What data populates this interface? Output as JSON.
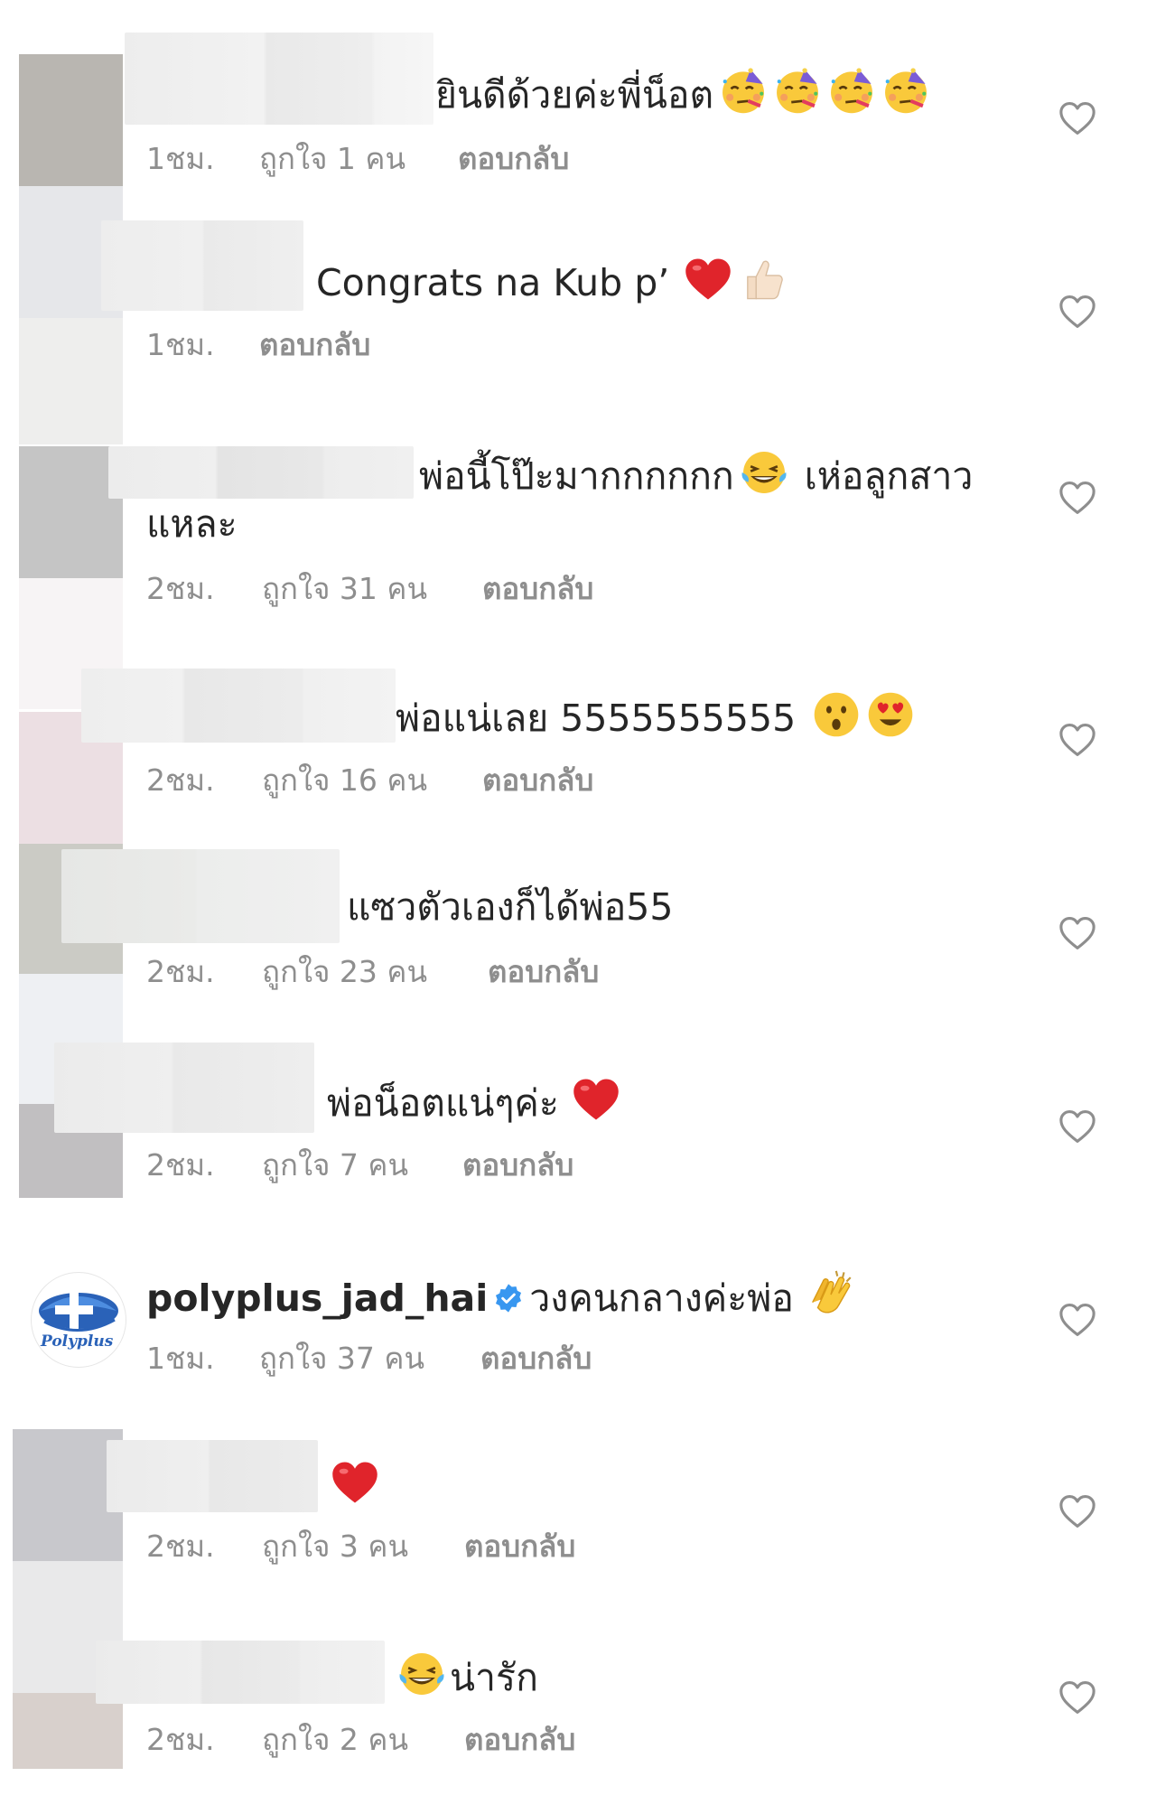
{
  "comments": [
    {
      "text": "ยินดีด้วยค่ะพี่น็อต",
      "time": "1ชม.",
      "likes": "ถูกใจ 1 คน",
      "reply": "ตอบกลับ",
      "emojis": [
        "partying-face",
        "partying-face",
        "partying-face",
        "partying-face"
      ]
    },
    {
      "text": "Congrats na Kub p’",
      "time": "1ชม.",
      "likes": "",
      "reply": "ตอบกลับ",
      "emojis": [
        "red-heart",
        "thumbs-up"
      ]
    },
    {
      "text": "พ่อนี้โป๊ะมากกกกกก",
      "text_after": "เห่อลูกสาว",
      "text_line2": "แหละ",
      "time": "2ชม.",
      "likes": "ถูกใจ 31 คน",
      "reply": "ตอบกลับ",
      "emojis": [
        "tears-of-joy"
      ]
    },
    {
      "text": "พ่อแน่เลย 5555555555",
      "time": "2ชม.",
      "likes": "ถูกใจ 16 คน",
      "reply": "ตอบกลับ",
      "emojis": [
        "surprised-face",
        "heart-eyes"
      ]
    },
    {
      "text": "แซวตัวเองก็ได้พ่อ55",
      "time": "2ชม.",
      "likes": "ถูกใจ 23 คน",
      "reply": "ตอบกลับ",
      "emojis": []
    },
    {
      "text": "พ่อน็อตแน่ๆค่ะ",
      "time": "2ชม.",
      "likes": "ถูกใจ 7 คน",
      "reply": "ตอบกลับ",
      "emojis": [
        "red-heart"
      ]
    },
    {
      "username": "polyplus_jad_hai",
      "verified": true,
      "avatar_logo_text": "Polyplus",
      "text": "วงคนกลางค่ะพ่อ",
      "time": "1ชม.",
      "likes": "ถูกใจ 37 คน",
      "reply": "ตอบกลับ",
      "emojis": [
        "clapping-hands"
      ]
    },
    {
      "text": "",
      "time": "2ชม.",
      "likes": "ถูกใจ 3 คน",
      "reply": "ตอบกลับ",
      "emojis": [
        "red-heart"
      ]
    },
    {
      "text": "น่ารัก",
      "time": "2ชม.",
      "likes": "ถูกใจ 2 คน",
      "reply": "ตอบกลับ",
      "emojis": [
        "tears-of-joy"
      ]
    }
  ],
  "colors": {
    "text": "#262626",
    "meta": "#8e8e8e",
    "verified": "#3897f0",
    "heart_outline": "#8e8e8e"
  }
}
